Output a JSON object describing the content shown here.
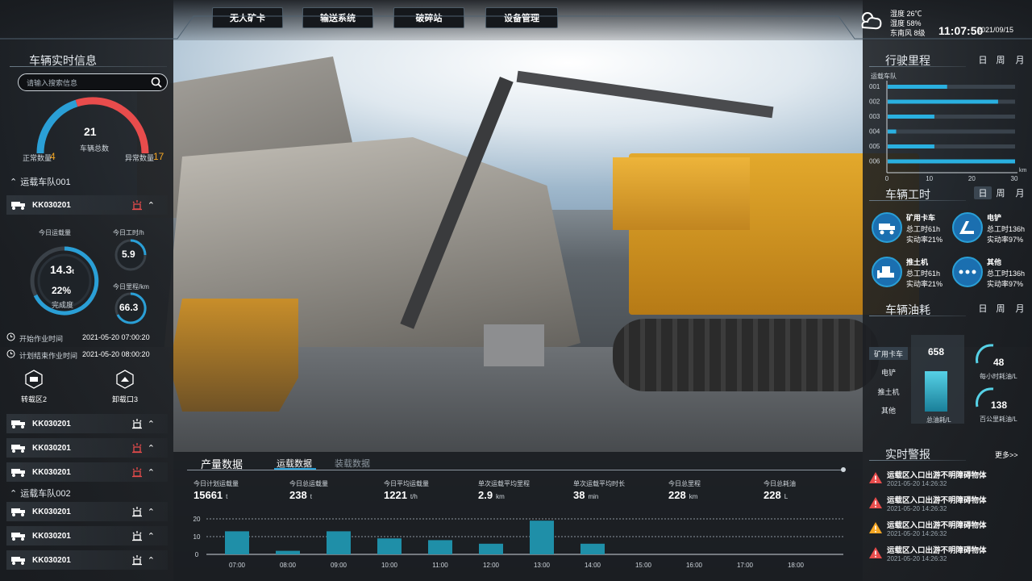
{
  "nav": [
    "无人矿卡",
    "输送系统",
    "破碎站",
    "设备管理"
  ],
  "weather": {
    "humidity_label": "湿度",
    "temp": "26℃",
    "humidity": "58%",
    "wind_label": "东南风",
    "wind": "8级",
    "time": "11:07:50",
    "date": "2021/09/15"
  },
  "left": {
    "title": "车辆实时信息",
    "search_placeholder": "请输入搜索信息",
    "total": {
      "value": "21",
      "label": "车辆总数",
      "normal_label": "正常数量",
      "normal": "4",
      "abnormal_label": "异常数量",
      "abnormal": "17"
    },
    "group1": "运载车队001",
    "group2": "运载车队002",
    "detail": {
      "haul_label": "今日运载量",
      "haul_value": "14.3",
      "haul_unit": "t",
      "complete_pct": "22%",
      "complete_label": "完成度",
      "hours_label": "今日工时/h",
      "hours_value": "5.9",
      "dist_label": "今日里程/km",
      "dist_value": "66.3",
      "start_label": "开始作业时间",
      "start_time": "2021-05-20 07:00:20",
      "end_label": "计划结束作业时间",
      "end_time": "2021-05-20 08:00:20",
      "load_zone": "转载区2",
      "unload_zone": "卸载口3"
    },
    "vehicles_g1": [
      "KK030201",
      "KK030201",
      "KK030201",
      "KK030201"
    ],
    "vehicles_g2": [
      "KK030201",
      "KK030201",
      "KK030201"
    ]
  },
  "right": {
    "mileage_title": "行驶里程",
    "periods": [
      "日",
      "周",
      "月"
    ],
    "mileage_ylabel": "运载车队",
    "mileage_unit": "km",
    "hours_title": "车辆工时",
    "fuel_title": "车辆油耗",
    "hours_items": [
      {
        "name": "矿用卡车",
        "total": "总工时61h",
        "rate": "实动率21%"
      },
      {
        "name": "电铲",
        "total": "总工时136h",
        "rate": "实动率97%"
      },
      {
        "name": "推土机",
        "total": "总工时61h",
        "rate": "实动率21%"
      },
      {
        "name": "其他",
        "total": "总工时136h",
        "rate": "实动率97%"
      }
    ],
    "fuel_tabs": [
      "矿用卡车",
      "电铲",
      "推土机",
      "其他"
    ],
    "fuel_total": "658",
    "fuel_total_label": "总油耗/L",
    "fuel_hour": "48",
    "fuel_hour_label": "每小时耗油/L",
    "fuel_km": "138",
    "fuel_km_label": "百公里耗油/L",
    "alert_title": "实时警报",
    "alert_more": "更多>>",
    "alerts": [
      {
        "text": "运载区入口出游不明障碍物体",
        "time": "2021-05-20 14:26:32",
        "level": "red"
      },
      {
        "text": "运载区入口出游不明障碍物体",
        "time": "2021-05-20 14:26:32",
        "level": "red"
      },
      {
        "text": "运载区入口出游不明障碍物体",
        "time": "2021-05-20 14:26:32",
        "level": "orange"
      },
      {
        "text": "运载区入口出游不明障碍物体",
        "time": "2021-05-20 14:26:32",
        "level": "red"
      }
    ]
  },
  "bottom": {
    "title": "产量数据",
    "tabs": [
      "运载数据",
      "装载数据"
    ],
    "stats": [
      {
        "label": "今日计划运载量",
        "value": "15661",
        "unit": "t"
      },
      {
        "label": "今日总运载量",
        "value": "238",
        "unit": "t"
      },
      {
        "label": "今日平均运载量",
        "value": "1221",
        "unit": "t/h"
      },
      {
        "label": "单次运载平均里程",
        "value": "2.9",
        "unit": "km"
      },
      {
        "label": "单次运载平均时长",
        "value": "38",
        "unit": "min"
      },
      {
        "label": "今日总里程",
        "value": "228",
        "unit": "km"
      },
      {
        "label": "今日总耗油",
        "value": "228",
        "unit": "L"
      }
    ]
  },
  "chart_data": [
    {
      "type": "bar",
      "orientation": "horizontal",
      "title": "行驶里程",
      "ylabel": "运载车队",
      "xlabel": "km",
      "categories": [
        "001",
        "002",
        "003",
        "004",
        "005",
        "006"
      ],
      "values": [
        14,
        26,
        11,
        2,
        11,
        30
      ],
      "xlim": [
        0,
        30
      ],
      "xticks": [
        0,
        10,
        20,
        30
      ]
    },
    {
      "type": "bar",
      "title": "运载数据",
      "categories": [
        "07:00",
        "08:00",
        "09:00",
        "10:00",
        "11:00",
        "12:00",
        "13:00",
        "14:00",
        "15:00",
        "16:00",
        "17:00",
        "18:00"
      ],
      "values": [
        13,
        2,
        13,
        9,
        8,
        6,
        19,
        6,
        0,
        0,
        0,
        0
      ],
      "ylim": [
        0,
        20
      ],
      "yticks": [
        0,
        10,
        20
      ]
    }
  ]
}
